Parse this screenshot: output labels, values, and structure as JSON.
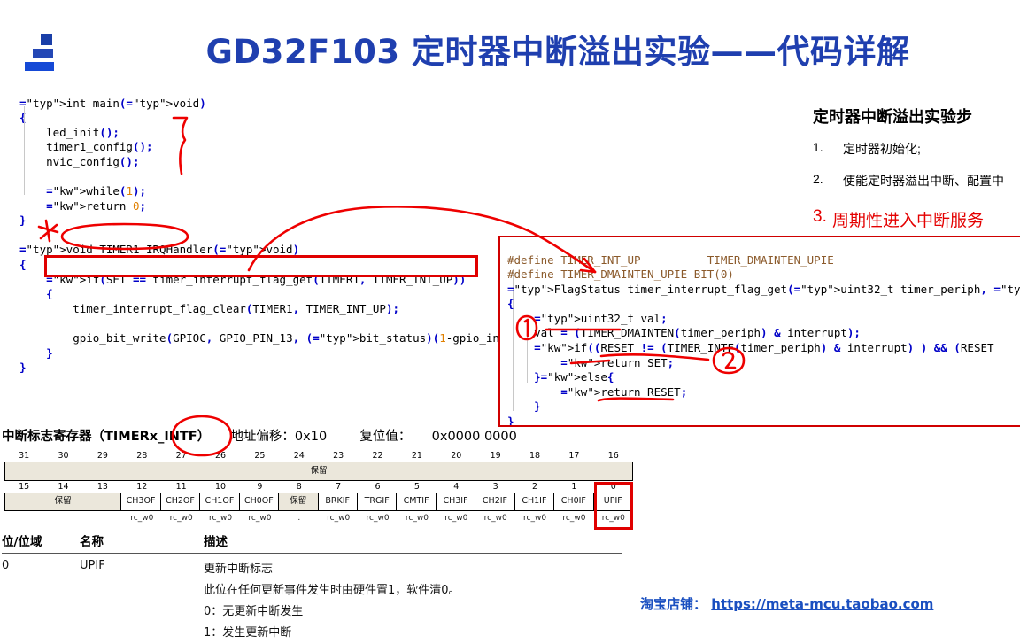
{
  "slide": {
    "title": "GD32F103 定时器中断溢出实验——代码详解",
    "logo_name": "brand-logo"
  },
  "code_left": {
    "lines": [
      "int main(void)",
      "{",
      "    led_init();",
      "    timer1_config();",
      "    nvic_config();",
      "",
      "    while(1);",
      "    return 0;",
      "}",
      "",
      "void TIMER1_IRQHandler(void)",
      "{",
      "    if(SET == timer_interrupt_flag_get(TIMER1, TIMER_INT_UP))",
      "    {",
      "        timer_interrupt_flag_clear(TIMER1, TIMER_INT_UP);",
      "",
      "        gpio_bit_write(GPIOC, GPIO_PIN_13, (bit_status)(1-gpio_inp",
      "    }",
      "}"
    ]
  },
  "code_right": {
    "lines": [
      "#define TIMER_INT_UP          TIMER_DMAINTEN_UPIE",
      "#define TIMER_DMAINTEN_UPIE BIT(0)",
      "FlagStatus timer_interrupt_flag_get(uint32_t timer_periph, uint32_t",
      "{",
      "    uint32_t val;",
      "    val = (TIMER_DMAINTEN(timer_periph) & interrupt);",
      "    if((RESET != (TIMER_INTF(timer_periph) & interrupt) ) && (RESET",
      "        return SET;",
      "    }else{",
      "        return RESET;",
      "    }",
      "}"
    ]
  },
  "steps": {
    "heading": "定时器中断溢出实验步",
    "items": [
      {
        "num": "1.",
        "text": "定时器初始化;"
      },
      {
        "num": "2.",
        "text": "使能定时器溢出中断、配置中"
      },
      {
        "num": "3.",
        "text": "周期性进入中断服务"
      }
    ]
  },
  "register": {
    "title_prefix": "中断标志寄存器（TIMERx_INTF）",
    "offset_label": "地址偏移：0x10",
    "reset_label": "复位值：",
    "reset_value": "0x0000 0000",
    "bits_high": [
      "31",
      "30",
      "29",
      "28",
      "27",
      "26",
      "25",
      "24",
      "23",
      "22",
      "21",
      "20",
      "19",
      "18",
      "17",
      "16"
    ],
    "bits_low": [
      "15",
      "14",
      "13",
      "12",
      "11",
      "10",
      "9",
      "8",
      "7",
      "6",
      "5",
      "4",
      "3",
      "2",
      "1",
      "0"
    ],
    "reserved_label": "保留",
    "row_high_cell": "保留",
    "row_low_cells": [
      {
        "label": "保留",
        "span": 3,
        "reserved": true,
        "access": ""
      },
      {
        "label": "CH3OF",
        "span": 1,
        "reserved": false,
        "access": "rc_w0"
      },
      {
        "label": "CH2OF",
        "span": 1,
        "reserved": false,
        "access": "rc_w0"
      },
      {
        "label": "CH1OF",
        "span": 1,
        "reserved": false,
        "access": "rc_w0"
      },
      {
        "label": "CH0OF",
        "span": 1,
        "reserved": false,
        "access": "rc_w0"
      },
      {
        "label": "保留",
        "span": 1,
        "reserved": true,
        "access": "."
      },
      {
        "label": "BRKIF",
        "span": 1,
        "reserved": false,
        "access": "rc_w0"
      },
      {
        "label": "TRGIF",
        "span": 1,
        "reserved": false,
        "access": "rc_w0"
      },
      {
        "label": "CMTIF",
        "span": 1,
        "reserved": false,
        "access": "rc_w0"
      },
      {
        "label": "CH3IF",
        "span": 1,
        "reserved": false,
        "access": "rc_w0"
      },
      {
        "label": "CH2IF",
        "span": 1,
        "reserved": false,
        "access": "rc_w0"
      },
      {
        "label": "CH1IF",
        "span": 1,
        "reserved": false,
        "access": "rc_w0"
      },
      {
        "label": "CH0IF",
        "span": 1,
        "reserved": false,
        "access": "rc_w0"
      },
      {
        "label": "UPIF",
        "span": 1,
        "reserved": false,
        "access": "rc_w0"
      }
    ]
  },
  "desc_table": {
    "headers": [
      "位/位域",
      "名称",
      "描述"
    ],
    "row": {
      "bit": "0",
      "name": "UPIF",
      "desc_lines": [
        "更新中断标志",
        "此位在任何更新事件发生时由硬件置1，软件清0。",
        "0：无更新中断发生",
        "1：发生更新中断"
      ]
    }
  },
  "footer": {
    "shop_label": "淘宝店铺：",
    "shop_url": "https://meta-mcu.taobao.com"
  },
  "annotations": {
    "circled_1": "1",
    "circled_2": "2",
    "accent_red": "#e00000",
    "accent_blue": "#1f3faf"
  }
}
